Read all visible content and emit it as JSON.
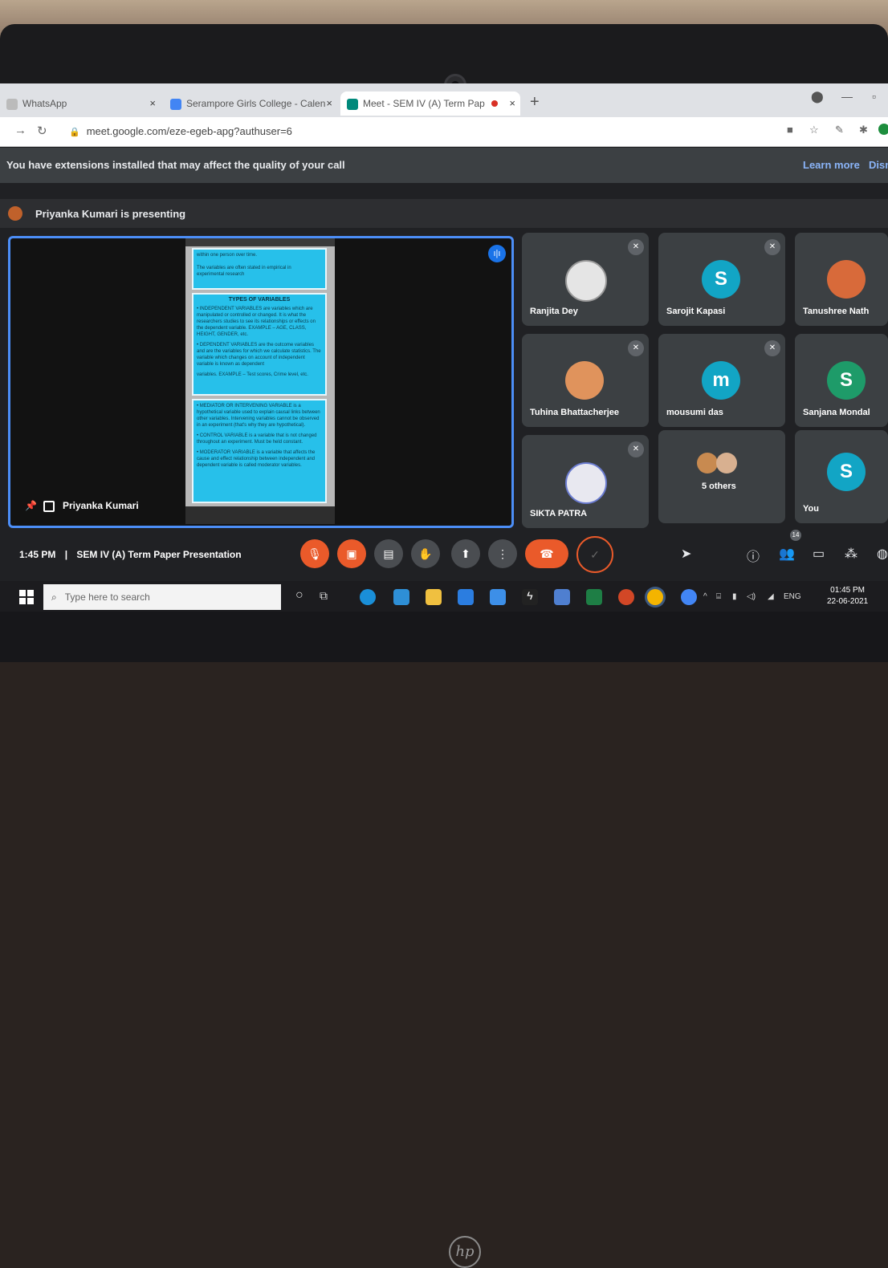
{
  "tabs": [
    {
      "label": "WhatsApp",
      "close": "×"
    },
    {
      "label": "Serampore Girls College - Calen",
      "close": "×"
    },
    {
      "label": "Meet - SEM IV (A) Term Pap",
      "close": "×"
    }
  ],
  "new_tab": "+",
  "address": {
    "url": "meet.google.com/eze-egeb-apg?authuser=6"
  },
  "extension_banner": {
    "message": "You have extensions installed that may affect the quality of your call",
    "learn_more": "Learn more",
    "dismiss": "Dism"
  },
  "presenting": {
    "message": "Priyanka Kumari is presenting"
  },
  "main_tile": {
    "presenter_name": "Priyanka Kumari",
    "document": {
      "page1_lines": [
        "within one person over time.",
        "The variables are often stated in empirical in",
        "experimental research"
      ],
      "page2_title": "TYPES OF VARIABLES",
      "page2_lines": [
        "• INDEPENDENT VARIABLES are variables which are manipulated or controlled or changed. It is what the researchers studies to see its relationships or effects on the dependent variable. EXAMPLE – AGE, CLASS, HEIGHT, GENDER, etc.",
        "• DEPENDENT VARIABLES are the outcome variables and are the variables for which we calculate statistics. The variable which changes on account of independent variable is known as dependent",
        "variables. EXAMPLE – Test scores, Crime level, etc."
      ],
      "page3_lines": [
        "• MEDIATOR OR INTERVENING VARIABLE is a hypothetical variable used to explain causal links between other variables. Intervening variables cannot be observed in an experiment (that's why they are hypothetical).",
        "• CONTROL VARIABLE is a variable that is not changed throughout an experiment. Must be held constant.",
        "• MODERATOR VARIABLE is a variable that affects the cause and effect relationship between independent and dependent variable is called moderator variables."
      ]
    }
  },
  "participants": [
    {
      "name": "Ranjita Dey",
      "initial": "",
      "color": "#e5e5e5",
      "muted": true
    },
    {
      "name": "Sarojit Kapasi",
      "initial": "S",
      "color": "#12a5c5",
      "muted": true
    },
    {
      "name": "Tanushree Nath",
      "initial": "",
      "color": "#d86a3a",
      "muted": false
    },
    {
      "name": "Tuhina Bhattacherjee",
      "initial": "",
      "color": "#e0935c",
      "muted": true
    },
    {
      "name": "mousumi das",
      "initial": "m",
      "color": "#12a5c5",
      "muted": true
    },
    {
      "name": "Sanjana Mondal",
      "initial": "S",
      "color": "#1e9b69",
      "muted": false
    },
    {
      "name": "SIKTA PATRA",
      "initial": "",
      "color": "#e8e8f0",
      "muted": true
    },
    {
      "name": "5 others",
      "initial": "",
      "color": "#c88a50",
      "muted": false
    },
    {
      "name": "You",
      "initial": "S",
      "color": "#12a5c5",
      "muted": false
    }
  ],
  "meeting": {
    "time": "1:45 PM",
    "separator": "|",
    "title": "SEM IV (A) Term Paper Presentation"
  },
  "people_count": "14",
  "taskbar": {
    "search_placeholder": "Type here to search",
    "lang": "ENG",
    "time": "01:45 PM",
    "date": "22-06-2021"
  },
  "icons": {
    "mic_off": "mic-off-icon",
    "cam_off": "camera-off-icon",
    "captions": "captions-icon",
    "raise_hand": "raise-hand-icon",
    "present": "present-icon",
    "more": "more-icon",
    "end_call": "end-call-icon"
  },
  "colors": {
    "accent": "#4c8ef7",
    "end_call": "#ea5a2a",
    "slide_bg": "#27c0ea"
  }
}
